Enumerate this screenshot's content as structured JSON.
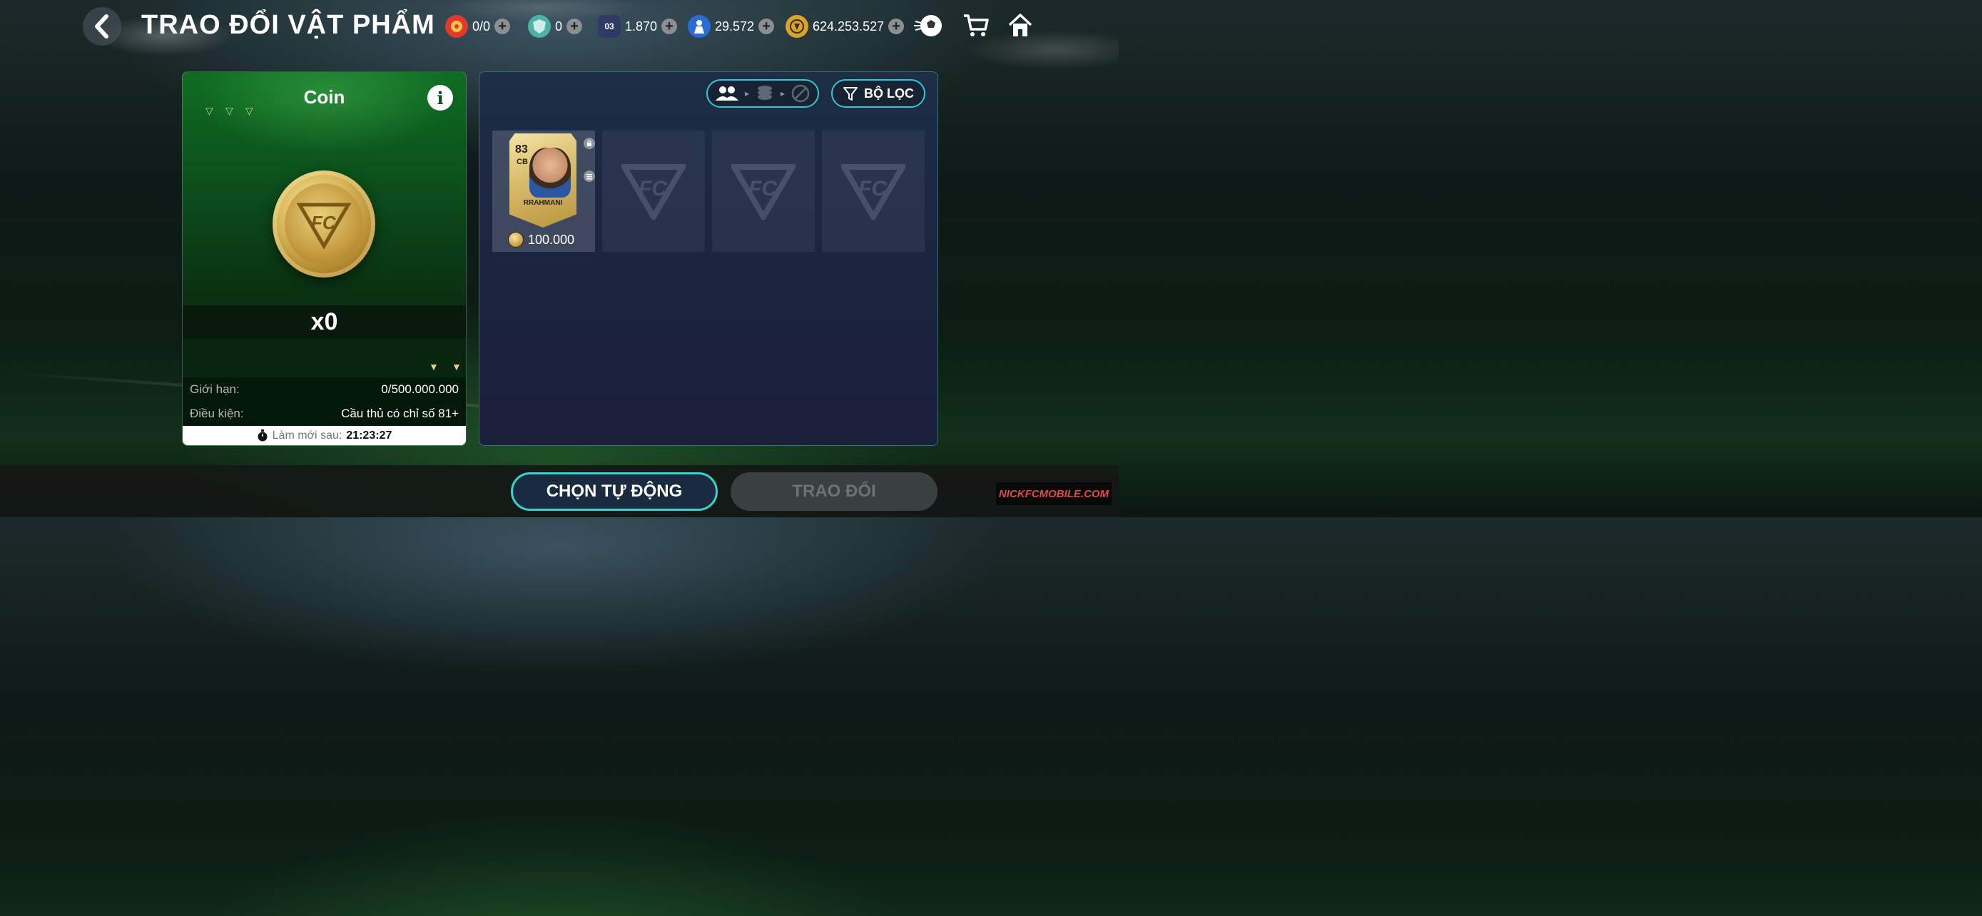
{
  "header": {
    "title": "TRAO ĐỔI VẬT PHẨM",
    "currencies": [
      {
        "icon": "gold-gear-icon",
        "value": "0/0",
        "color": "#e03a2a"
      },
      {
        "icon": "shield-gem-icon",
        "value": "0",
        "color": "#4bb3a6"
      },
      {
        "icon": "card-pack-icon",
        "value": "1.870",
        "badge": "03",
        "color": "#2f3b66"
      },
      {
        "icon": "player-token-icon",
        "value": "29.572",
        "color": "#2a6bd6"
      },
      {
        "icon": "fc-coin-icon",
        "value": "624.253.527",
        "color": "#d8a52a"
      }
    ],
    "icons": [
      "soccer-ball-icon",
      "shopping-cart-icon",
      "home-icon"
    ]
  },
  "left_panel": {
    "title": "Coin",
    "quantity": "x0",
    "limit_label": "Giới hạn:",
    "limit_value": "0/500.000.000",
    "condition_label": "Điều kiện:",
    "condition_value": "Cầu thủ có chỉ số 81+",
    "refresh_label": "Làm mới sau:",
    "refresh_time": "21:23:27"
  },
  "right_panel": {
    "filter_label": "BỘ LỌC",
    "slots": [
      {
        "filled": true,
        "player_rating": "83",
        "player_position": "CB",
        "player_name": "RRAHMANI",
        "price": "100.000"
      },
      {
        "filled": false
      },
      {
        "filled": false
      },
      {
        "filled": false
      }
    ]
  },
  "footer": {
    "auto_select_label": "CHỌN TỰ ĐỘNG",
    "trade_label": "TRAO ĐỔI",
    "watermark": "NICKFCMOBILE.COM"
  },
  "colors": {
    "accent_cyan": "#39d3cf",
    "panel_green": "#0c4a1a",
    "panel_navy": "#1b2641",
    "gold": "#c59a3d"
  }
}
